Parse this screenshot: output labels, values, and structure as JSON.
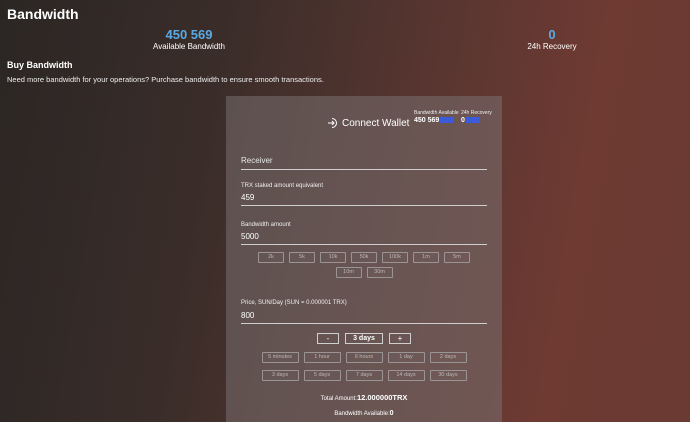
{
  "header": {
    "title": "Bandwidth",
    "available_value": "450 569",
    "available_label": "Available Bandwidth",
    "recovery_value": "0",
    "recovery_label": "24h Recovery"
  },
  "buy": {
    "title": "Buy Bandwidth",
    "subtitle": "Need more bandwidth for your operations? Purchase bandwidth to ensure smooth transactions."
  },
  "panel": {
    "connect_label": "Connect Wallet",
    "mini_available_label": "Bandwidth Available",
    "mini_available_value": "450 569",
    "mini_recovery_label": "24h Recovery",
    "mini_recovery_value": "0",
    "receiver_placeholder": "Receiver",
    "trx_label": "TRX staked amount equivalent",
    "trx_value": "459",
    "bandwidth_label": "Bandwidth amount",
    "bandwidth_value": "5000",
    "bandwidth_chips": [
      "2k",
      "5k",
      "10k",
      "50k",
      "100k",
      "1m",
      "5m",
      "10m",
      "30m"
    ],
    "price_label": "Price, SUN/Day (SUN = 0.000001 TRX)",
    "price_value": "800",
    "stepper_minus": "-",
    "stepper_value": "3 days",
    "stepper_plus": "+",
    "duration_chips": [
      "5 minutes",
      "1 hour",
      "6 hours",
      "1 day",
      "2 days",
      "3 days",
      "5 days",
      "7 days",
      "14 days",
      "30 days"
    ],
    "total_label": "Total Amount:",
    "total_value": "12.000000TRX",
    "bw_available_label": "Bandwidth Available:",
    "bw_available_value": "0"
  },
  "colors": {
    "accent": "#5aa9e6",
    "bar": "#3b5bd9"
  },
  "icons": {
    "connect": "login-arrow-icon"
  }
}
